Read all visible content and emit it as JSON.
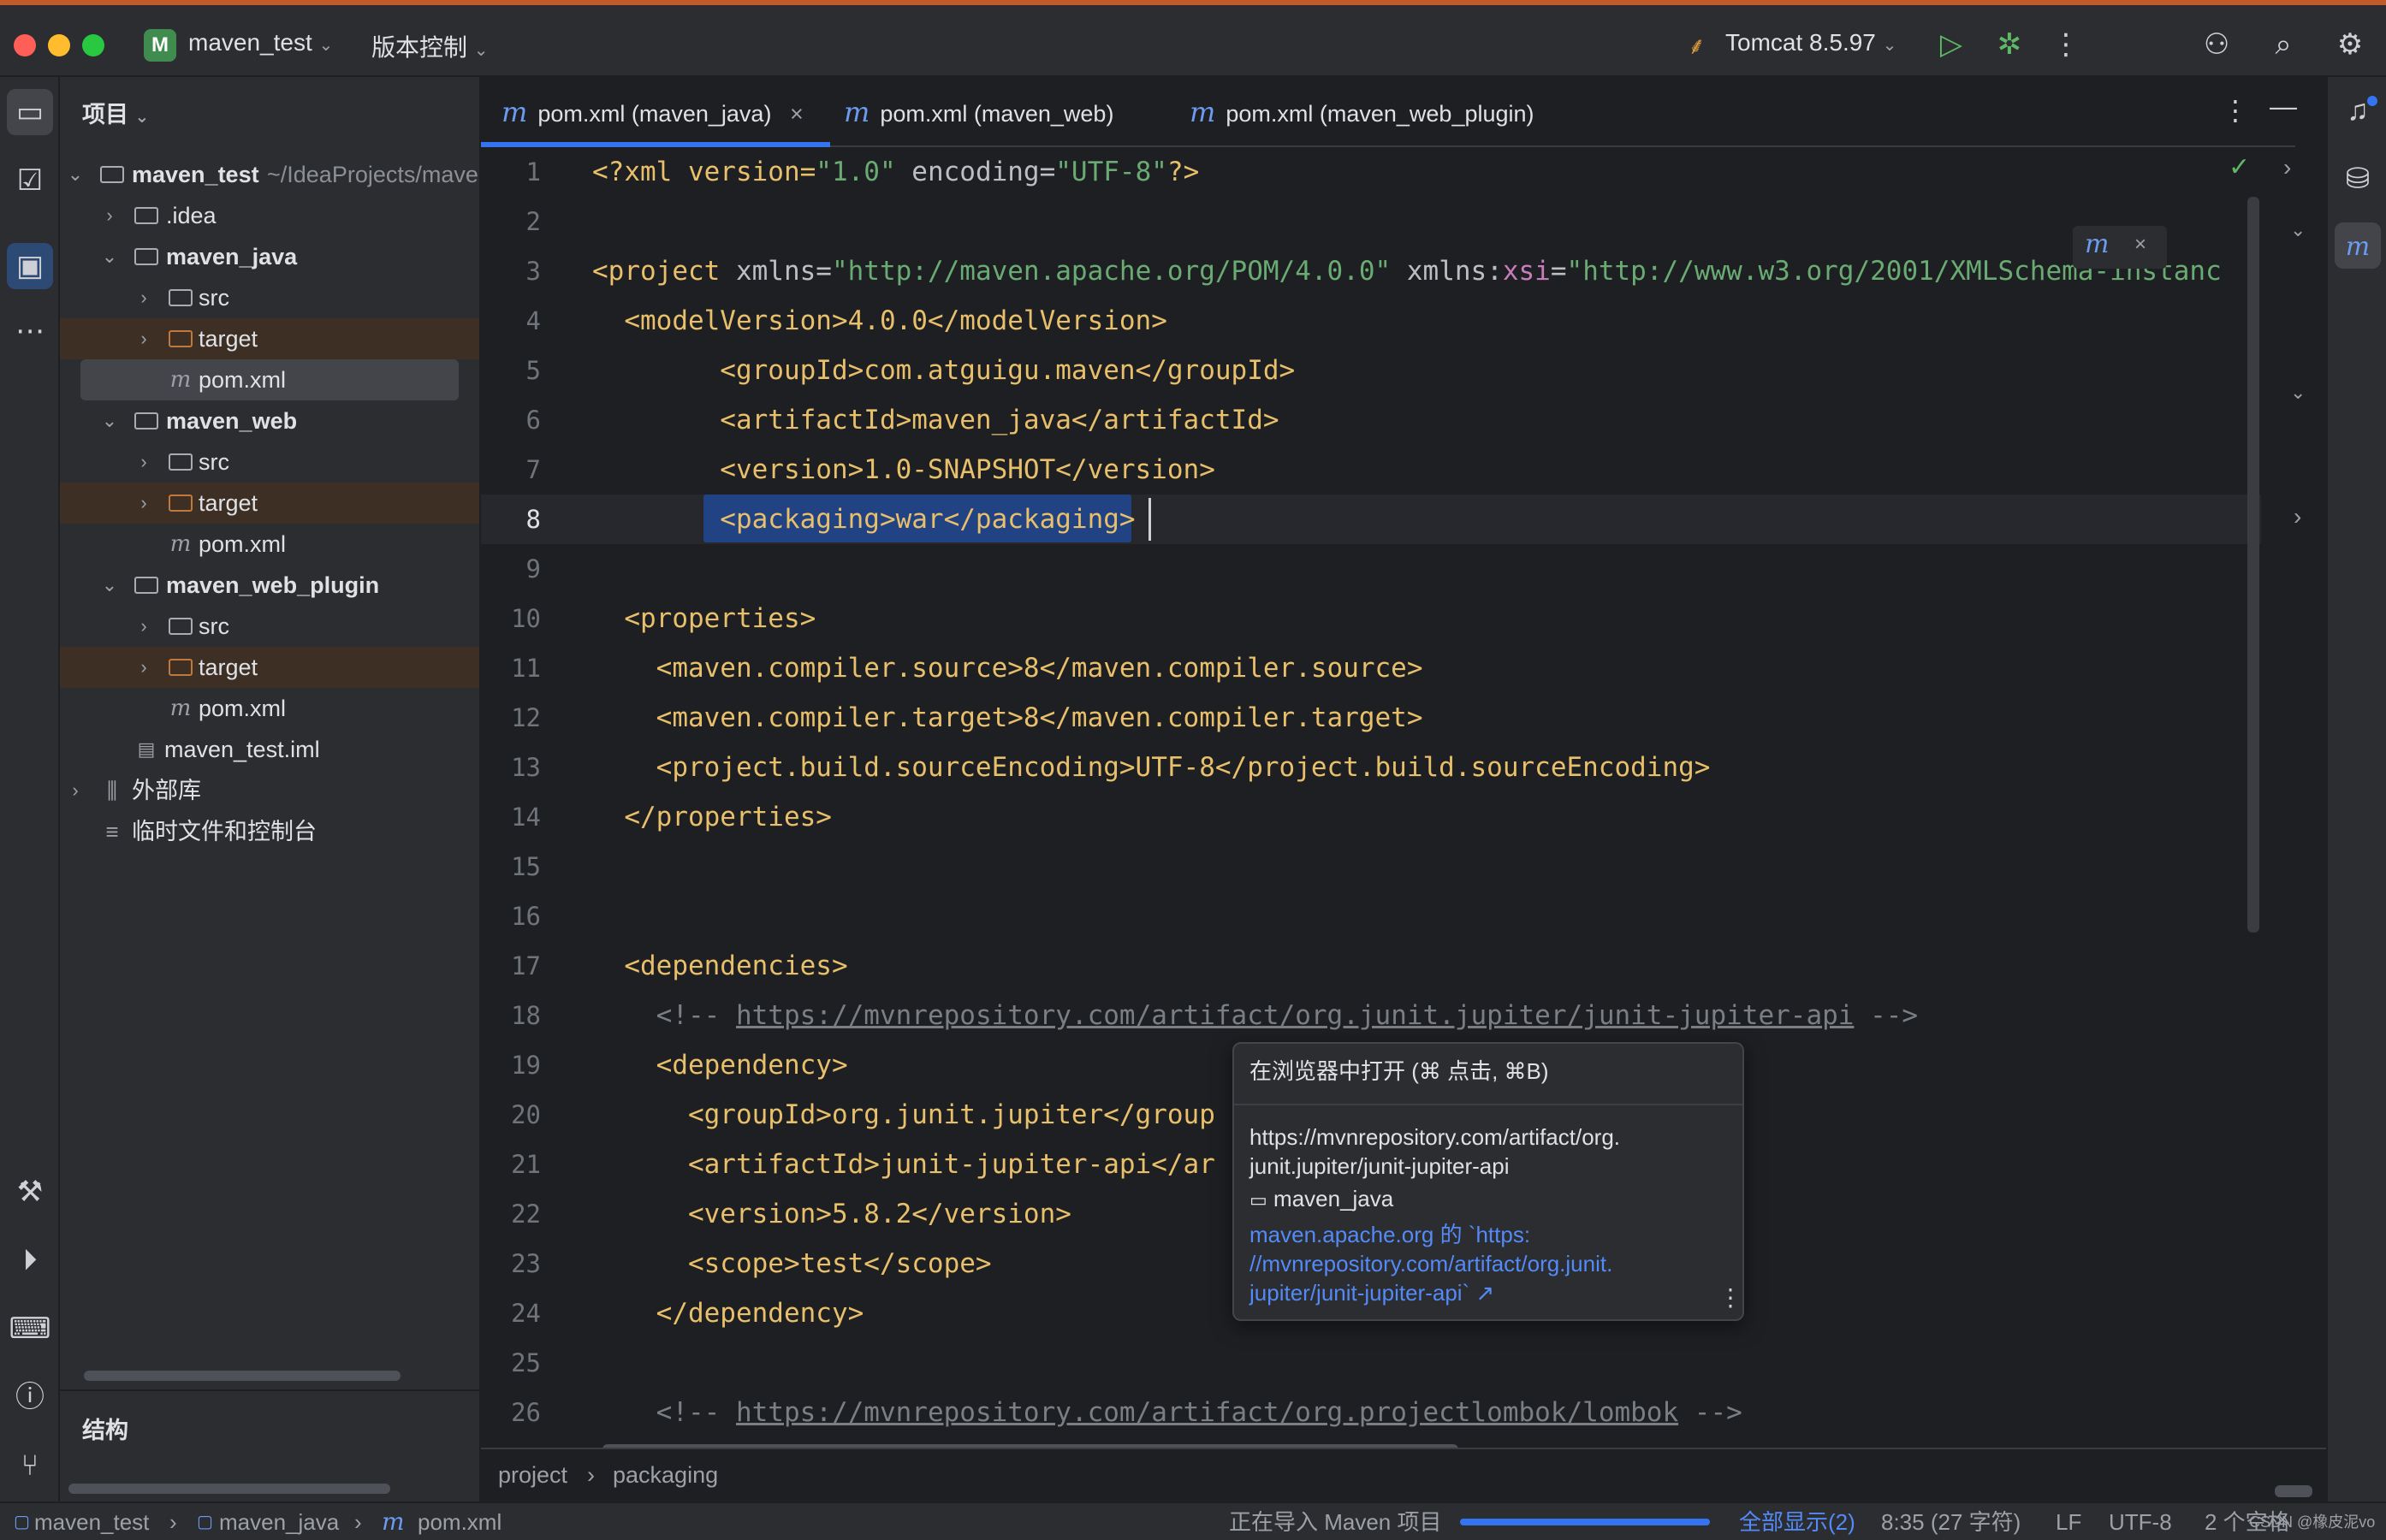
{
  "titlebar": {
    "project_badge": "M",
    "project_name": "maven_test",
    "vcs_menu": "版本控制",
    "run_config": "Tomcat 8.5.97"
  },
  "project_panel": {
    "title": "项目",
    "tree": [
      {
        "label": "maven_test",
        "suffix": "~/IdeaProjects/mave"
      },
      {
        "label": ".idea"
      },
      {
        "label": "maven_java"
      },
      {
        "label": "src"
      },
      {
        "label": "target"
      },
      {
        "label": "pom.xml"
      },
      {
        "label": "maven_web"
      },
      {
        "label": "src"
      },
      {
        "label": "target"
      },
      {
        "label": "pom.xml"
      },
      {
        "label": "maven_web_plugin"
      },
      {
        "label": "src"
      },
      {
        "label": "target"
      },
      {
        "label": "pom.xml"
      },
      {
        "label": "maven_test.iml"
      },
      {
        "label": "外部库"
      },
      {
        "label": "临时文件和控制台"
      }
    ],
    "structure_title": "结构"
  },
  "tabs": [
    {
      "icon": "m",
      "label": "pom.xml (maven_java)",
      "close": "×"
    },
    {
      "icon": "m",
      "label": "pom.xml (maven_web)"
    },
    {
      "icon": "m",
      "label": "pom.xml (maven_web_plugin)"
    }
  ],
  "editor": {
    "current_line": 8,
    "lines": [
      [
        "1",
        "2",
        "3",
        "4",
        "5",
        "6",
        "7",
        "8",
        "9",
        "10",
        "11",
        "12",
        "13",
        "14",
        "15",
        "16",
        "17",
        "18",
        "19",
        "20",
        "21",
        "22",
        "23",
        "24",
        "25",
        "26"
      ]
    ],
    "code": {
      "l1a": "<?xml version=",
      "l1b": "\"1.0\"",
      "l1c": " encoding=",
      "l1d": "\"UTF-8\"",
      "l1e": "?>",
      "l3a": "<project ",
      "l3b": "xmlns=",
      "l3c": "\"http://maven.apache.org/POM/4.0.0\"",
      "l3d": " xmlns:",
      "l3e": "xsi",
      "l3f": "=",
      "l3g": "\"http://www.w3.org/2001/XMLSchema-instanc",
      "l4": "  <modelVersion>4.0.0</modelVersion>",
      "l5": "        <groupId>com.atguigu.maven</groupId>",
      "l6": "        <artifactId>maven_java</artifactId>",
      "l7": "        <version>1.0-SNAPSHOT</version>",
      "l8": "        <packaging>war</packaging>",
      "l10": "  <properties>",
      "l11": "    <maven.compiler.source>8</maven.compiler.source>",
      "l12": "    <maven.compiler.target>8</maven.compiler.target>",
      "l13": "    <project.build.sourceEncoding>UTF-8</project.build.sourceEncoding>",
      "l14": "  </properties>",
      "l17": "  <dependencies>",
      "l18a": "    <!-- ",
      "l18b": "https://mvnrepository.com/artifact/org.junit.jupiter/junit-jupiter-api",
      "l18c": " -->",
      "l19": "    <dependency>",
      "l20": "      <groupId>org.junit.jupiter</group",
      "l21": "      <artifactId>junit-jupiter-api</ar",
      "l22": "      <version>5.8.2</version>",
      "l23": "      <scope>test</scope>",
      "l24": "    </dependency>",
      "l26a": "    <!-- ",
      "l26b": "https://mvnrepository.com/artifact/org.projectlombok/lombok",
      "l26c": " -->"
    }
  },
  "popup": {
    "header": "在浏览器中打开 (⌘ 点击, ⌘B)",
    "url_line1": "https://mvnrepository.com/artifact/org.",
    "url_line2": "junit.jupiter/junit-jupiter-api",
    "module": "maven_java",
    "link_line1": "maven.apache.org 的 `https:",
    "link_line2": "//mvnrepository.com/artifact/org.junit.",
    "link_line3": "jupiter/junit-jupiter-api` ↗"
  },
  "breadcrumb": {
    "items": [
      "project",
      "packaging"
    ]
  },
  "statusbar": {
    "path": [
      "maven_test",
      "maven_java",
      "pom.xml"
    ],
    "task": "正在导入 Maven 项目",
    "progress": 1.0,
    "show_all": "全部显示(2)",
    "position": "8:35 (27 字符)",
    "line_sep": "LF",
    "encoding": "UTF-8",
    "indent": "2 个空格",
    "watermark": "CSDN @橡皮泥vo"
  },
  "colors": {
    "accent": "#3574f0",
    "tag": "#e8bf6a",
    "string": "#6aab73",
    "comment": "#7a7e85",
    "link": "#548af7"
  }
}
